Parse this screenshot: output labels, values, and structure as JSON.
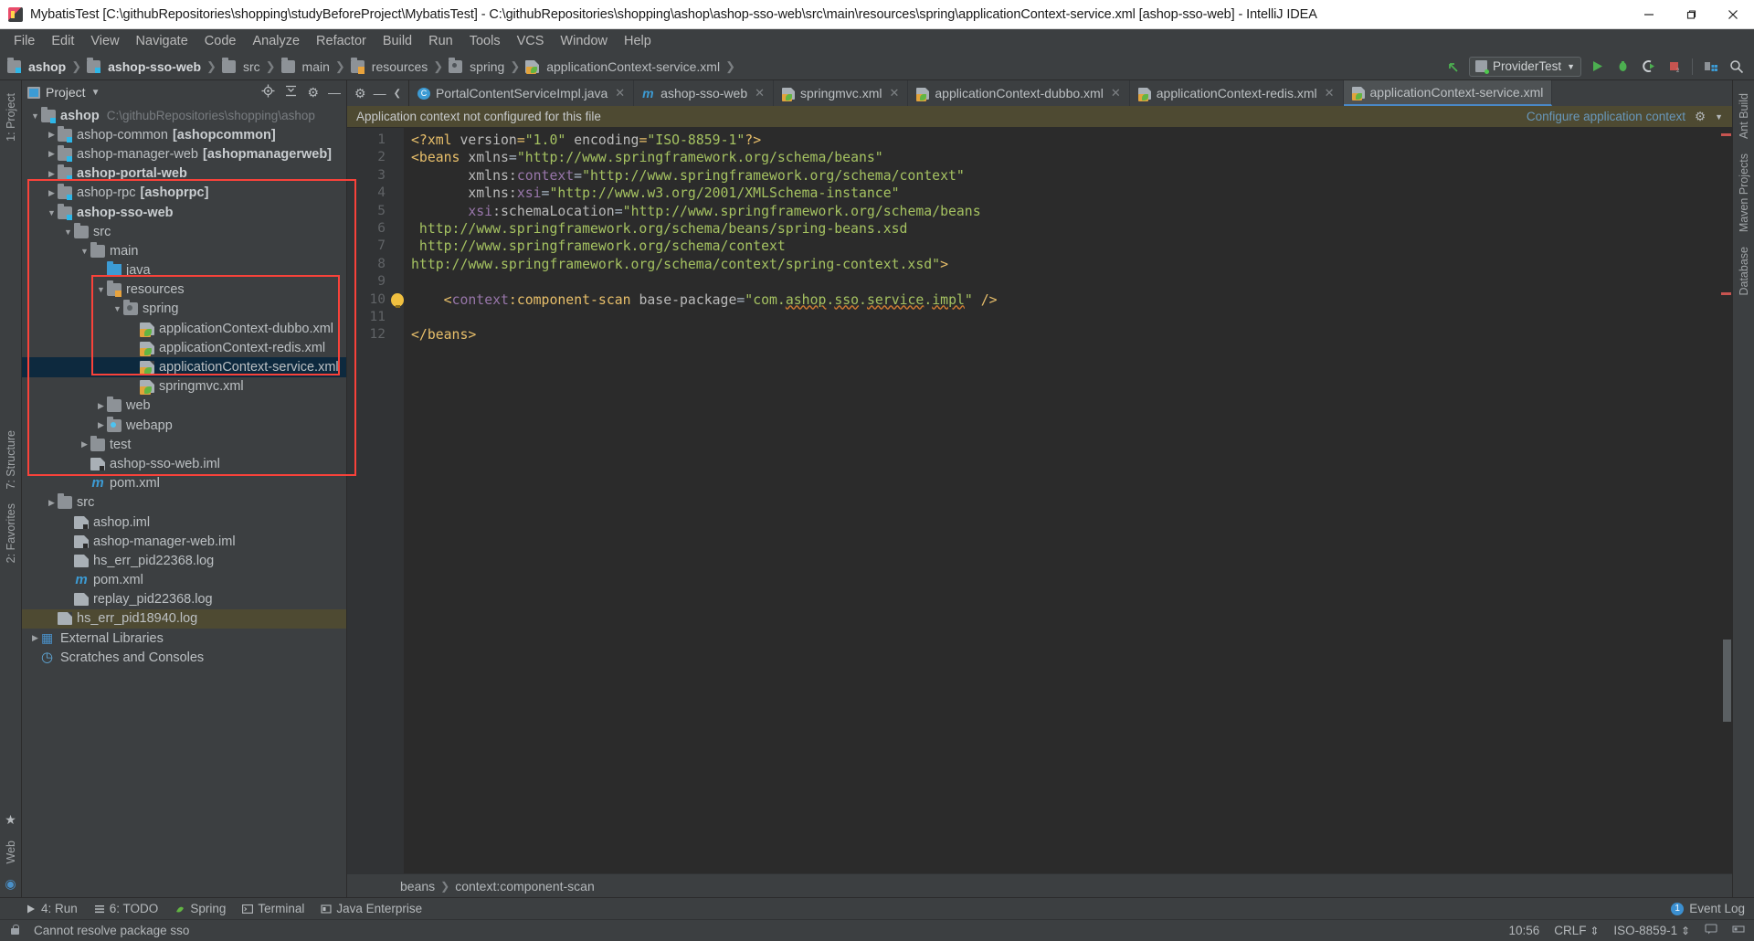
{
  "window": {
    "title": "MybatisTest [C:\\githubRepositories\\shopping\\studyBeforeProject\\MybatisTest] - C:\\githubRepositories\\shopping\\ashop\\ashop-sso-web\\src\\main\\resources\\spring\\applicationContext-service.xml [ashop-sso-web] - IntelliJ IDEA",
    "minimize": "—",
    "maximize": "❐",
    "close": "✕"
  },
  "menu": [
    "File",
    "Edit",
    "View",
    "Navigate",
    "Code",
    "Analyze",
    "Refactor",
    "Build",
    "Run",
    "Tools",
    "VCS",
    "Window",
    "Help"
  ],
  "navbar": {
    "crumbs": [
      {
        "label": "ashop",
        "icon": "module-folder-icon",
        "bold": true
      },
      {
        "label": "ashop-sso-web",
        "icon": "module-folder-icon",
        "bold": true
      },
      {
        "label": "src",
        "icon": "folder-icon",
        "bold": false
      },
      {
        "label": "main",
        "icon": "folder-icon",
        "bold": false
      },
      {
        "label": "resources",
        "icon": "resources-folder-icon",
        "bold": false
      },
      {
        "label": "spring",
        "icon": "spring-folder-icon",
        "bold": false
      },
      {
        "label": "applicationContext-service.xml",
        "icon": "xml-file-icon",
        "bold": false
      }
    ],
    "run_config": "ProviderTest",
    "icons": [
      "back-arrow-icon",
      "run-icon",
      "debug-icon",
      "run-with-coverage-icon",
      "stop-icon",
      "project-structure-icon",
      "search-icon"
    ]
  },
  "left_rail": [
    "1: Project",
    "7: Structure",
    "2: Favorites",
    "Web"
  ],
  "right_rail": [
    "Ant Build",
    "Maven Projects",
    "Database"
  ],
  "project_panel": {
    "title": "Project",
    "actions": [
      "locate-icon",
      "collapse-all-icon",
      "settings-icon",
      "minimize-icon"
    ],
    "tree": [
      {
        "depth": 0,
        "arrow": "open",
        "icon": "module-folder-icon",
        "label": "ashop",
        "bold": true,
        "path": "C:\\githubRepositories\\shopping\\ashop"
      },
      {
        "depth": 1,
        "arrow": "closed",
        "icon": "module-folder-icon",
        "label": "ashop-common",
        "sub": "[ashopcommon]"
      },
      {
        "depth": 1,
        "arrow": "closed",
        "icon": "module-folder-icon",
        "label": "ashop-manager-web",
        "sub": "[ashopmanagerweb]"
      },
      {
        "depth": 1,
        "arrow": "closed",
        "icon": "module-folder-icon",
        "label": "ashop-portal-web",
        "bold": true
      },
      {
        "depth": 1,
        "arrow": "closed",
        "icon": "module-folder-icon",
        "label": "ashop-rpc",
        "sub": "[ashoprpc]"
      },
      {
        "depth": 1,
        "arrow": "open",
        "icon": "module-folder-icon",
        "label": "ashop-sso-web",
        "bold": true
      },
      {
        "depth": 2,
        "arrow": "open",
        "icon": "folder-icon",
        "label": "src"
      },
      {
        "depth": 3,
        "arrow": "open",
        "icon": "folder-icon",
        "label": "main"
      },
      {
        "depth": 4,
        "arrow": "none",
        "icon": "source-folder-icon",
        "label": "java"
      },
      {
        "depth": 4,
        "arrow": "open",
        "icon": "resources-folder-icon",
        "label": "resources"
      },
      {
        "depth": 5,
        "arrow": "open",
        "icon": "spring-folder-icon",
        "label": "spring"
      },
      {
        "depth": 6,
        "arrow": "none",
        "icon": "xml-file-icon",
        "label": "applicationContext-dubbo.xml"
      },
      {
        "depth": 6,
        "arrow": "none",
        "icon": "xml-file-icon",
        "label": "applicationContext-redis.xml"
      },
      {
        "depth": 6,
        "arrow": "none",
        "icon": "xml-file-icon",
        "label": "applicationContext-service.xml",
        "selected": true
      },
      {
        "depth": 6,
        "arrow": "none",
        "icon": "xml-file-icon",
        "label": "springmvc.xml"
      },
      {
        "depth": 4,
        "arrow": "closed",
        "icon": "folder-icon",
        "label": "web"
      },
      {
        "depth": 4,
        "arrow": "closed",
        "icon": "webapp-folder-icon",
        "label": "webapp"
      },
      {
        "depth": 3,
        "arrow": "closed",
        "icon": "folder-icon",
        "label": "test"
      },
      {
        "depth": 3,
        "arrow": "none",
        "icon": "iml-file-icon",
        "label": "ashop-sso-web.iml"
      },
      {
        "depth": 3,
        "arrow": "none",
        "icon": "maven-file-icon",
        "label": "pom.xml"
      },
      {
        "depth": 1,
        "arrow": "closed",
        "icon": "folder-icon",
        "label": "src"
      },
      {
        "depth": 2,
        "arrow": "none",
        "icon": "iml-file-icon",
        "label": "ashop.iml"
      },
      {
        "depth": 2,
        "arrow": "none",
        "icon": "iml-file-icon",
        "label": "ashop-manager-web.iml"
      },
      {
        "depth": 2,
        "arrow": "none",
        "icon": "log-file-icon",
        "label": "hs_err_pid22368.log"
      },
      {
        "depth": 2,
        "arrow": "none",
        "icon": "maven-file-icon",
        "label": "pom.xml"
      },
      {
        "depth": 2,
        "arrow": "none",
        "icon": "log-file-icon",
        "label": "replay_pid22368.log"
      },
      {
        "depth": 1,
        "arrow": "none",
        "icon": "log-file-icon",
        "label": "hs_err_pid18940.log",
        "highlighted": true
      },
      {
        "depth": 0,
        "arrow": "closed",
        "icon": "libraries-icon",
        "label": "External Libraries"
      },
      {
        "depth": 0,
        "arrow": "none",
        "icon": "scratches-icon",
        "label": "Scratches and Consoles"
      }
    ]
  },
  "editor": {
    "tabs": [
      {
        "label": "PortalContentServiceImpl.java",
        "icon": "java-class-icon",
        "active": false
      },
      {
        "label": "ashop-sso-web",
        "icon": "maven-module-icon",
        "active": false
      },
      {
        "label": "springmvc.xml",
        "icon": "spring-xml-icon",
        "active": false
      },
      {
        "label": "applicationContext-dubbo.xml",
        "icon": "spring-xml-icon",
        "active": false
      },
      {
        "label": "applicationContext-redis.xml",
        "icon": "spring-xml-icon",
        "active": false
      },
      {
        "label": "applicationContext-service.xml",
        "icon": "spring-xml-icon",
        "active": true
      }
    ],
    "notification": {
      "message": "Application context not configured for this file",
      "action": "Configure application context",
      "gear": "⚙"
    },
    "line_numbers": [
      "1",
      "2",
      "3",
      "4",
      "5",
      "6",
      "7",
      "8",
      "9",
      "10",
      "11",
      "12"
    ],
    "code_lines": [
      {
        "n": 1,
        "segments": [
          {
            "t": "pi",
            "v": "<?xml "
          },
          {
            "t": "attr",
            "v": "version"
          },
          {
            "t": "pi",
            "v": "="
          },
          {
            "t": "str",
            "v": "\"1.0\""
          },
          {
            "t": "attr",
            "v": " encoding"
          },
          {
            "t": "pi",
            "v": "="
          },
          {
            "t": "str",
            "v": "\"ISO-8859-1\""
          },
          {
            "t": "pi",
            "v": "?>"
          }
        ]
      },
      {
        "n": 2,
        "segments": [
          {
            "t": "tag",
            "v": "<beans "
          },
          {
            "t": "attr",
            "v": "xmlns"
          },
          {
            "t": "plain",
            "v": "="
          },
          {
            "t": "str",
            "v": "\"http://www.springframework.org/schema/beans\""
          }
        ]
      },
      {
        "n": 3,
        "segments": [
          {
            "t": "plain",
            "v": "       "
          },
          {
            "t": "attr",
            "v": "xmlns:"
          },
          {
            "t": "ns",
            "v": "context"
          },
          {
            "t": "plain",
            "v": "="
          },
          {
            "t": "str",
            "v": "\"http://www.springframework.org/schema/context\""
          }
        ]
      },
      {
        "n": 4,
        "segments": [
          {
            "t": "plain",
            "v": "       "
          },
          {
            "t": "attr",
            "v": "xmlns:"
          },
          {
            "t": "ns",
            "v": "xsi"
          },
          {
            "t": "plain",
            "v": "="
          },
          {
            "t": "str",
            "v": "\"http://www.w3.org/2001/XMLSchema-instance\""
          }
        ]
      },
      {
        "n": 5,
        "segments": [
          {
            "t": "plain",
            "v": "       "
          },
          {
            "t": "ns",
            "v": "xsi"
          },
          {
            "t": "attr",
            "v": ":schemaLocation"
          },
          {
            "t": "plain",
            "v": "="
          },
          {
            "t": "str",
            "v": "\"http://www.springframework.org/schema/beans"
          }
        ]
      },
      {
        "n": 6,
        "segments": [
          {
            "t": "str",
            "v": " http://www.springframework.org/schema/beans/spring-beans.xsd"
          }
        ]
      },
      {
        "n": 7,
        "segments": [
          {
            "t": "str",
            "v": " http://www.springframework.org/schema/context"
          }
        ]
      },
      {
        "n": 8,
        "segments": [
          {
            "t": "str",
            "v": "http://www.springframework.org/schema/context/spring-context.xsd\""
          },
          {
            "t": "tag",
            "v": ">"
          }
        ]
      },
      {
        "n": 9,
        "segments": [
          {
            "t": "plain",
            "v": ""
          }
        ]
      },
      {
        "n": 10,
        "segments": [
          {
            "t": "plain",
            "v": "    "
          },
          {
            "t": "tag",
            "v": "<"
          },
          {
            "t": "ns",
            "v": "context"
          },
          {
            "t": "tag",
            "v": ":component-scan "
          },
          {
            "t": "attr",
            "v": "base-package"
          },
          {
            "t": "plain",
            "v": "="
          },
          {
            "t": "str",
            "v": "\"com."
          },
          {
            "t": "err",
            "v": "ashop"
          },
          {
            "t": "str",
            "v": "."
          },
          {
            "t": "err",
            "v": "sso"
          },
          {
            "t": "str",
            "v": "."
          },
          {
            "t": "err",
            "v": "service"
          },
          {
            "t": "str",
            "v": "."
          },
          {
            "t": "err",
            "v": "impl"
          },
          {
            "t": "str",
            "v": "\""
          },
          {
            "t": "tag",
            "v": " />"
          }
        ]
      },
      {
        "n": 11,
        "segments": [
          {
            "t": "plain",
            "v": ""
          }
        ]
      },
      {
        "n": 12,
        "segments": [
          {
            "t": "tag",
            "v": "</beans>"
          }
        ]
      }
    ],
    "breadcrumb": [
      "beans",
      "context:component-scan"
    ]
  },
  "bottom_toolwindows": [
    {
      "label": "4: Run",
      "icon": "run-icon"
    },
    {
      "label": "6: TODO",
      "icon": "todo-icon"
    },
    {
      "label": "Spring",
      "icon": "spring-icon"
    },
    {
      "label": "Terminal",
      "icon": "terminal-icon"
    },
    {
      "label": "Java Enterprise",
      "icon": "java-enterprise-icon"
    }
  ],
  "event_log": {
    "label": "Event Log",
    "count": "1"
  },
  "statusbar": {
    "message": "Cannot resolve package sso",
    "time": "10:56",
    "line_separator": "CRLF",
    "encoding": "ISO-8859-1",
    "lock_icon": "lock-icon",
    "hint_icon": "balloon-icon"
  }
}
